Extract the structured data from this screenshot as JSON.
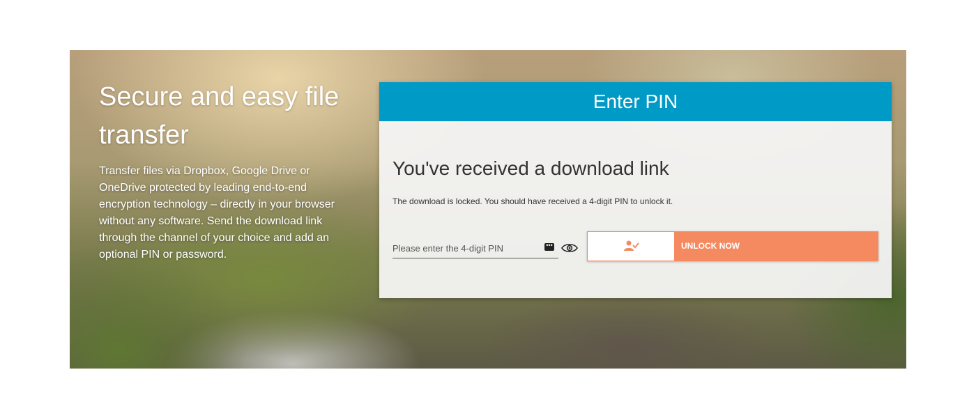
{
  "hero": {
    "title": "Secure and easy file transfer",
    "description": "Transfer files via Dropbox, Google Drive or OneDrive protected by leading end-to-end encryption technology – directly in your browser without any software. Send the download link through the channel of your choice and add an optional PIN or password."
  },
  "card": {
    "header": "Enter PIN",
    "heading": "You've received a download link",
    "message": "The download is locked. You should have received a 4-digit PIN to unlock it.",
    "pin_input": {
      "value": "",
      "placeholder": "Please enter the 4-digit PIN"
    },
    "unlock_button": {
      "label": "UNLOCK NOW",
      "icon": "user-check-icon"
    },
    "icons": {
      "keys": "password-manager-icon",
      "eye": "show-password-icon"
    }
  },
  "colors": {
    "header_blue": "#009ac7",
    "button_orange": "#f58a60"
  }
}
